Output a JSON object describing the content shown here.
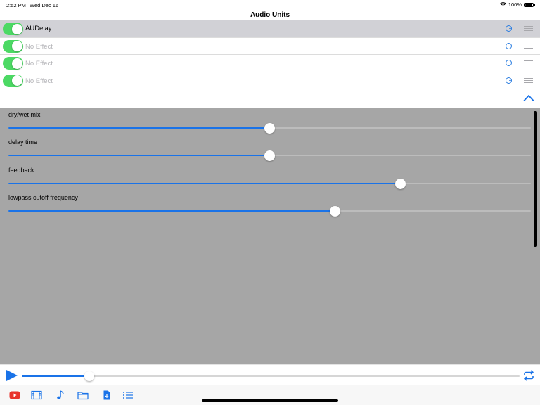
{
  "status_bar": {
    "time": "2:52 PM",
    "date": "Wed Dec 16",
    "battery": "100%"
  },
  "title": "Audio Units",
  "effects": [
    {
      "label": "AUDelay",
      "enabled": true,
      "selected": true
    },
    {
      "label": "No Effect",
      "enabled": true,
      "selected": false
    },
    {
      "label": "No Effect",
      "enabled": true,
      "selected": false
    },
    {
      "label": "No Effect",
      "enabled": true,
      "selected": false
    }
  ],
  "parameters": [
    {
      "label": "dry/wet mix",
      "value": 0.5
    },
    {
      "label": "delay time",
      "value": 0.5
    },
    {
      "label": "feedback",
      "value": 0.75
    },
    {
      "label": "lowpass cutoff frequency",
      "value": 0.625
    }
  ],
  "playback": {
    "progress": 0.135
  },
  "colors": {
    "accent": "#1a73e8",
    "toggle_on": "#4cd964",
    "param_bg": "#a6a6a6",
    "selected_row": "#d1d1d6",
    "youtube_red": "#e8322b"
  },
  "icons": {
    "more": "ellipsis-circle-icon",
    "reorder": "grip-lines-icon",
    "collapse": "chevron-up-icon",
    "play": "play-icon",
    "repeat": "repeat-icon",
    "toolbar": [
      "youtube-icon",
      "film-icon",
      "music-note-icon",
      "folder-icon",
      "document-download-icon",
      "list-icon"
    ]
  }
}
